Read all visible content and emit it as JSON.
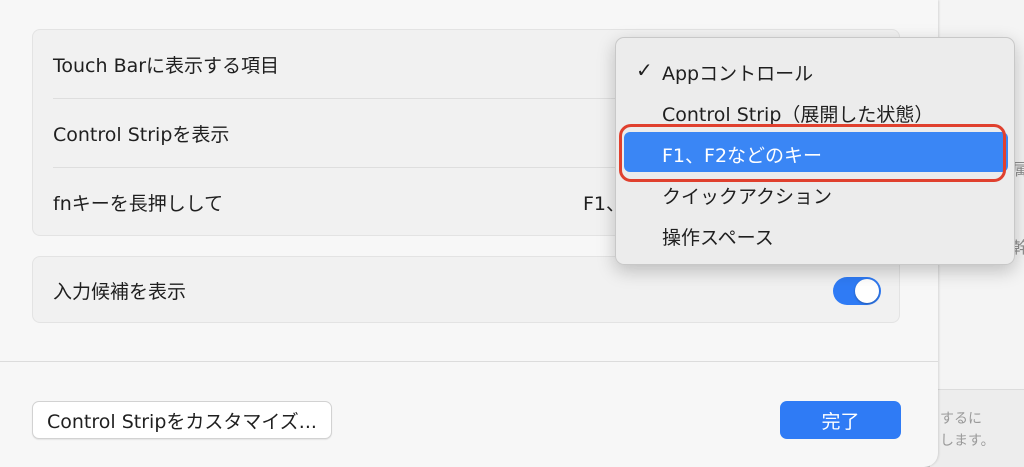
{
  "background_window": {
    "frag1": "属",
    "frag2": "幹",
    "text_line1": "するに",
    "text_line2": "します。"
  },
  "settings": {
    "touchbar_row": {
      "label": "Touch Barに表示する項目"
    },
    "control_strip_row": {
      "label": "Control Stripを表示"
    },
    "fn_row": {
      "label": "fnキーを長押しして",
      "value": "F1、"
    },
    "suggestions_row": {
      "label": "入力候補を表示",
      "toggle_on": true
    }
  },
  "footer": {
    "customize_label": "Control Stripをカスタマイズ...",
    "done_label": "完了"
  },
  "menu": {
    "items": [
      {
        "label": "Appコントロール",
        "checked": true,
        "highlighted": false
      },
      {
        "label": "Control Strip（展開した状態）",
        "checked": false,
        "highlighted": false
      },
      {
        "label": "F1、F2などのキー",
        "checked": false,
        "highlighted": true
      },
      {
        "label": "クイックアクション",
        "checked": false,
        "highlighted": false
      },
      {
        "label": "操作スペース",
        "checked": false,
        "highlighted": false
      }
    ],
    "check_glyph": "✓"
  },
  "colors": {
    "accent": "#2f7bf5",
    "menu_highlight": "#3a86f5",
    "annotation_ring": "#e0402e"
  }
}
